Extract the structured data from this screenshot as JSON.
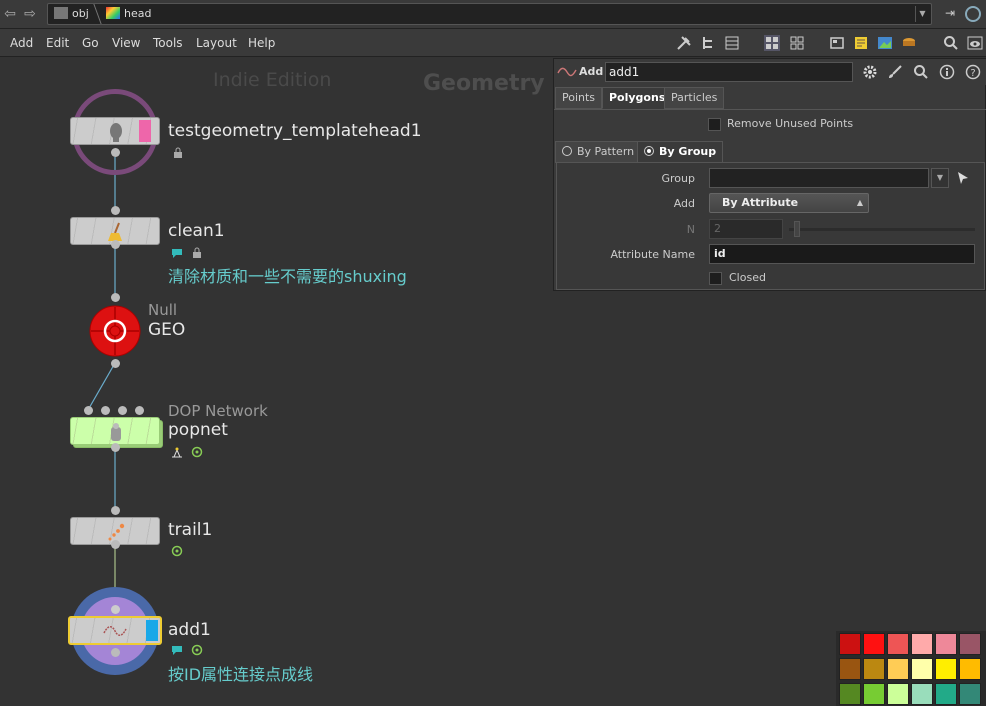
{
  "path": {
    "crumbs": [
      "obj",
      "head"
    ]
  },
  "menu": [
    "Add",
    "Edit",
    "Go",
    "View",
    "Tools",
    "Layout",
    "Help"
  ],
  "network": {
    "watermark": "Indie Edition",
    "context": "Geometry",
    "nodes": [
      {
        "name": "testgeometry_templatehead1",
        "type": "",
        "comment": ""
      },
      {
        "name": "clean1",
        "type": "",
        "comment": "清除材质和一些不需要的shuxing"
      },
      {
        "name": "GEO",
        "type": "Null",
        "comment": ""
      },
      {
        "name": "popnet",
        "type": "DOP Network",
        "comment": ""
      },
      {
        "name": "trail1",
        "type": "",
        "comment": ""
      },
      {
        "name": "add1",
        "type": "",
        "comment": "按ID属性连接点成线"
      }
    ]
  },
  "params": {
    "type_label": "Add",
    "node_name": "add1",
    "tabs": [
      "Points",
      "Polygons",
      "Particles"
    ],
    "active_tab": "Polygons",
    "remove_unused": "Remove Unused Points",
    "subtabs": [
      "By Pattern",
      "By Group"
    ],
    "active_subtab": "By Group",
    "fields": {
      "group_label": "Group",
      "group_value": "",
      "add_label": "Add",
      "add_value": "By Attribute",
      "n_label": "N",
      "n_value": "2",
      "attr_label": "Attribute Name",
      "attr_value": "id",
      "closed_label": "Closed"
    }
  },
  "palette": {
    "colors": [
      "#cc1111",
      "#ff1111",
      "#ee5555",
      "#ffaaaa",
      "#ee8899",
      "#995566",
      "#995511",
      "#bb8811",
      "#ffcc55",
      "#ffffaa",
      "#ffee00",
      "#ffbb00",
      "#558822",
      "#77cc33",
      "#ccff99",
      "#99ddbb",
      "#22aa88",
      "#338877"
    ]
  }
}
